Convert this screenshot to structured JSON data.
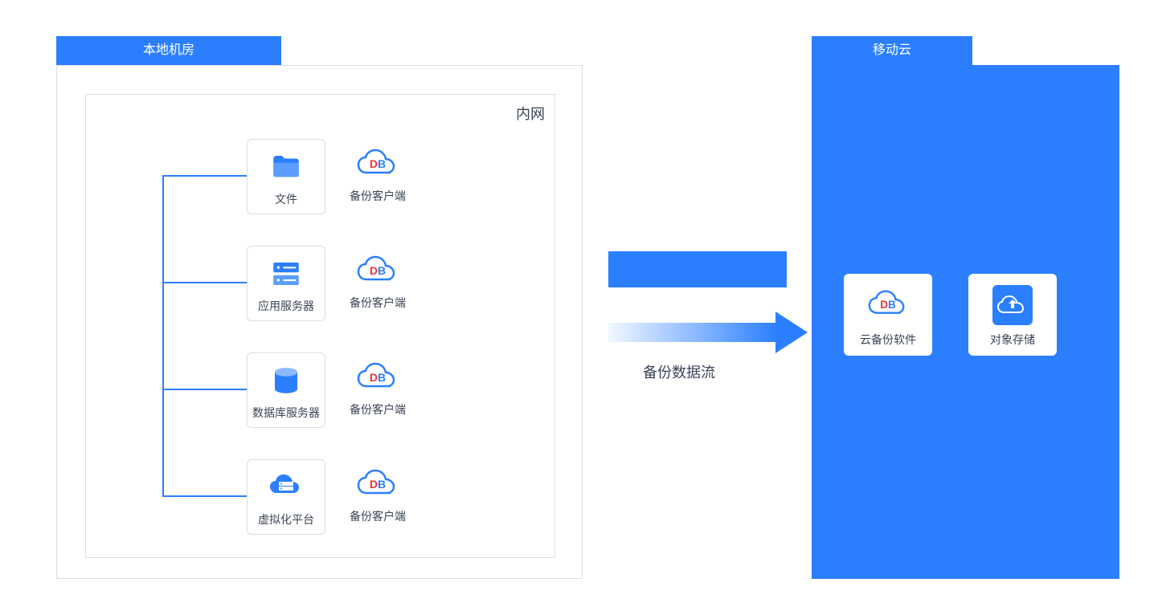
{
  "left": {
    "header": "本地机房",
    "inner_label": "内网",
    "nodes": [
      {
        "label": "文件",
        "client_label": "备份客户端"
      },
      {
        "label": "应用服务器",
        "client_label": "备份客户端"
      },
      {
        "label": "数据库服务器",
        "client_label": "备份客户端"
      },
      {
        "label": "虚拟化平台",
        "client_label": "备份客户端"
      }
    ]
  },
  "flow": {
    "label": "备份数据流"
  },
  "right": {
    "header": "移动云",
    "nodes": [
      {
        "label": "云备份软件"
      },
      {
        "label": "对象存储"
      }
    ]
  },
  "colors": {
    "primary": "#2b7fff"
  }
}
